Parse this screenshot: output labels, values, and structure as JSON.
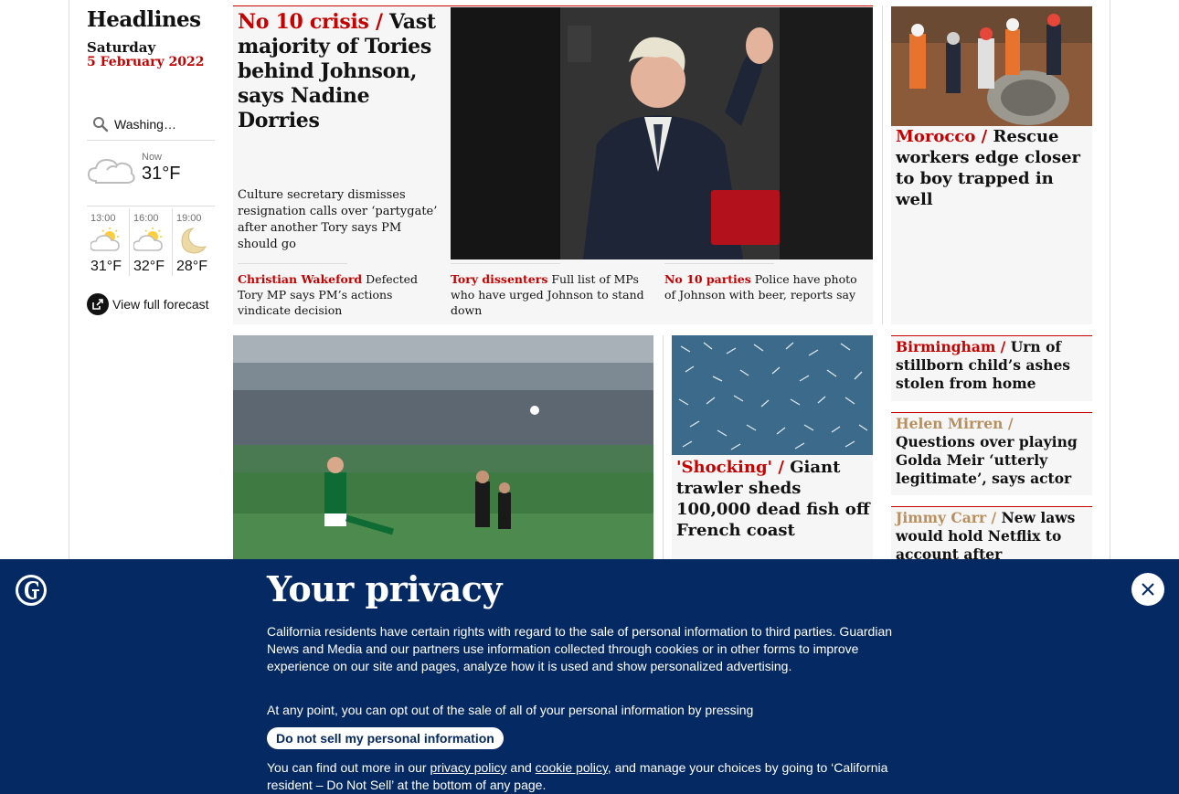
{
  "sidebar": {
    "title": "Headlines",
    "day": "Saturday",
    "date": "5 February 2022"
  },
  "weather": {
    "location": "Washing…",
    "now_label": "Now",
    "now_temp": "31°F",
    "now_icon": "cloudy-icon",
    "forecast": [
      {
        "time": "13:00",
        "temp": "31°F",
        "icon": "sun-cloud-icon"
      },
      {
        "time": "16:00",
        "temp": "32°F",
        "icon": "sun-cloud-icon"
      },
      {
        "time": "19:00",
        "temp": "28°F",
        "icon": "moon-icon"
      }
    ],
    "full_forecast_label": "View full forecast"
  },
  "top_story": {
    "kicker": "No 10 crisis /",
    "headline": "Vast majority of Tories behind Johnson, says Nadine Dorries",
    "standfirst": "Culture secretary dismisses resignation calls over ‘partygate’ after another Tory says PM should go",
    "sublinks": [
      {
        "kicker": "Christian Wakeford",
        "text": "Defected Tory MP says PM’s actions vindicate decision"
      },
      {
        "kicker": "Tory dissenters",
        "text": "Full list of MPs who have urged Johnson to stand down"
      },
      {
        "kicker": "No 10 parties",
        "text": "Police have photo of Johnson with beer, reports say"
      }
    ]
  },
  "morocco": {
    "kicker": "Morocco /",
    "headline": "Rescue workers edge closer to boy trapped in well"
  },
  "fish": {
    "kicker": "'Shocking' /",
    "headline": "Giant trawler sheds 100,000 dead fish off French coast"
  },
  "side_items": [
    {
      "kicker": "Birmingham /",
      "headline": "Urn of stillborn child’s ashes stolen from home"
    },
    {
      "kicker": "Helen Mirren /",
      "headline": "Questions over playing Golda Meir ‘utterly legitimate’, says actor"
    },
    {
      "kicker": "Jimmy Carr /",
      "headline": "New laws would hold Netflix to account after ‘shocking’"
    }
  ],
  "privacy": {
    "title": "Your privacy",
    "paragraph1": "California residents have certain rights with regard to the sale of personal information to third parties. Guardian News and Media and our partners use information collected through cookies or in other forms to improve experience on our site and pages, analyze how it is used and show personalized advertising.",
    "paragraph2": "At any point, you can opt out of the sale of all of your personal information by pressing",
    "button": "Do not sell my personal information",
    "p3_before": "You can find out more in our ",
    "p3_link1": "privacy policy",
    "p3_mid": " and ",
    "p3_link2": "cookie policy",
    "p3_after": ", and manage your choices by going to ‘California resident – Do Not Sell’ at the bottom of any page."
  },
  "colors": {
    "accent": "#c70000",
    "banner_bg": "#052962",
    "card_bg": "#f6f6f6"
  }
}
